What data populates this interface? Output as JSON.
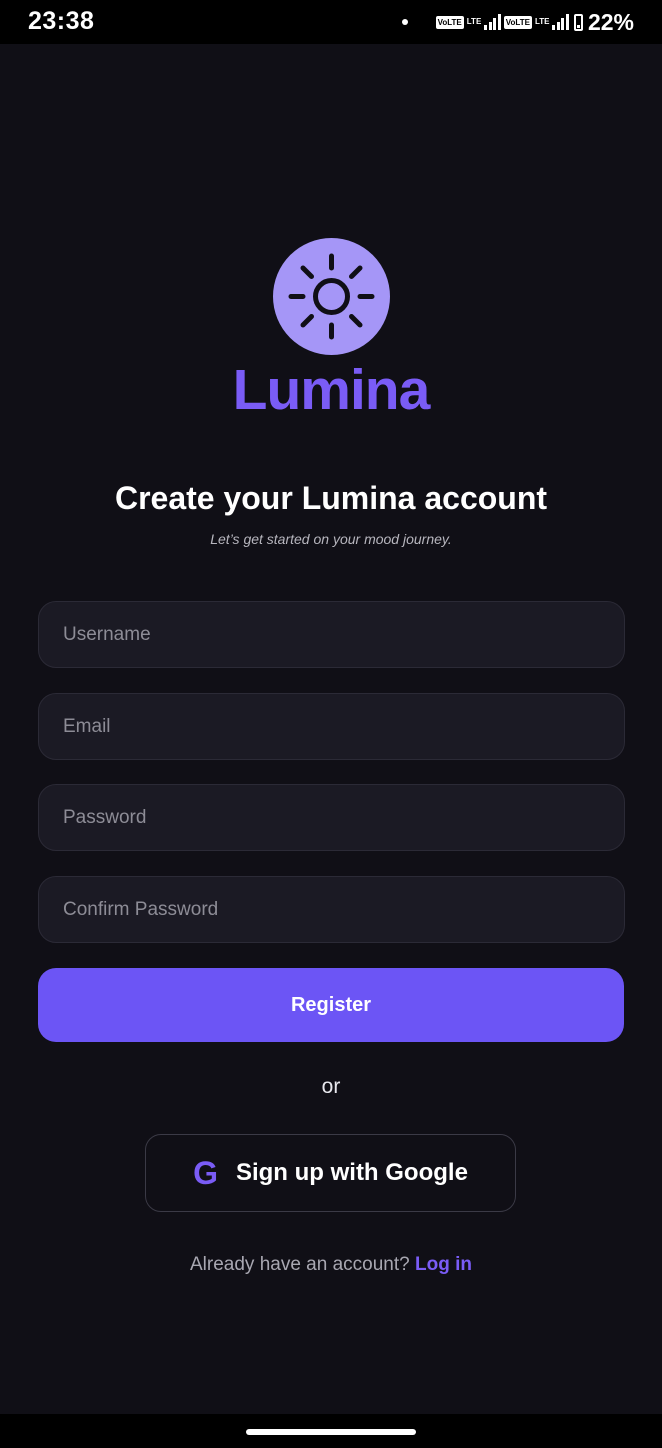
{
  "status_bar": {
    "time": "23:38",
    "sim1_badge": "VoLTE",
    "sim1_network": "LTE",
    "sim2_badge": "VoLTE",
    "sim2_network": "LTE",
    "battery_percent": "22%"
  },
  "brand": {
    "name": "Lumina",
    "logo_icon": "sun-icon",
    "accent_color": "#7a5cf6",
    "logo_bg_color": "#a596f7"
  },
  "header": {
    "title": "Create your Lumina account",
    "subtitle": "Let’s get started on your mood journey."
  },
  "form": {
    "username_placeholder": "Username",
    "email_placeholder": "Email",
    "password_placeholder": "Password",
    "confirm_password_placeholder": "Confirm Password",
    "register_label": "Register",
    "register_color": "#6c55f5"
  },
  "divider": {
    "or_text": "or"
  },
  "google": {
    "icon": "google-g-icon",
    "glyph": "G",
    "label": "Sign up with Google"
  },
  "footer": {
    "prompt": "Already have an account?",
    "login_label": "Log in"
  }
}
